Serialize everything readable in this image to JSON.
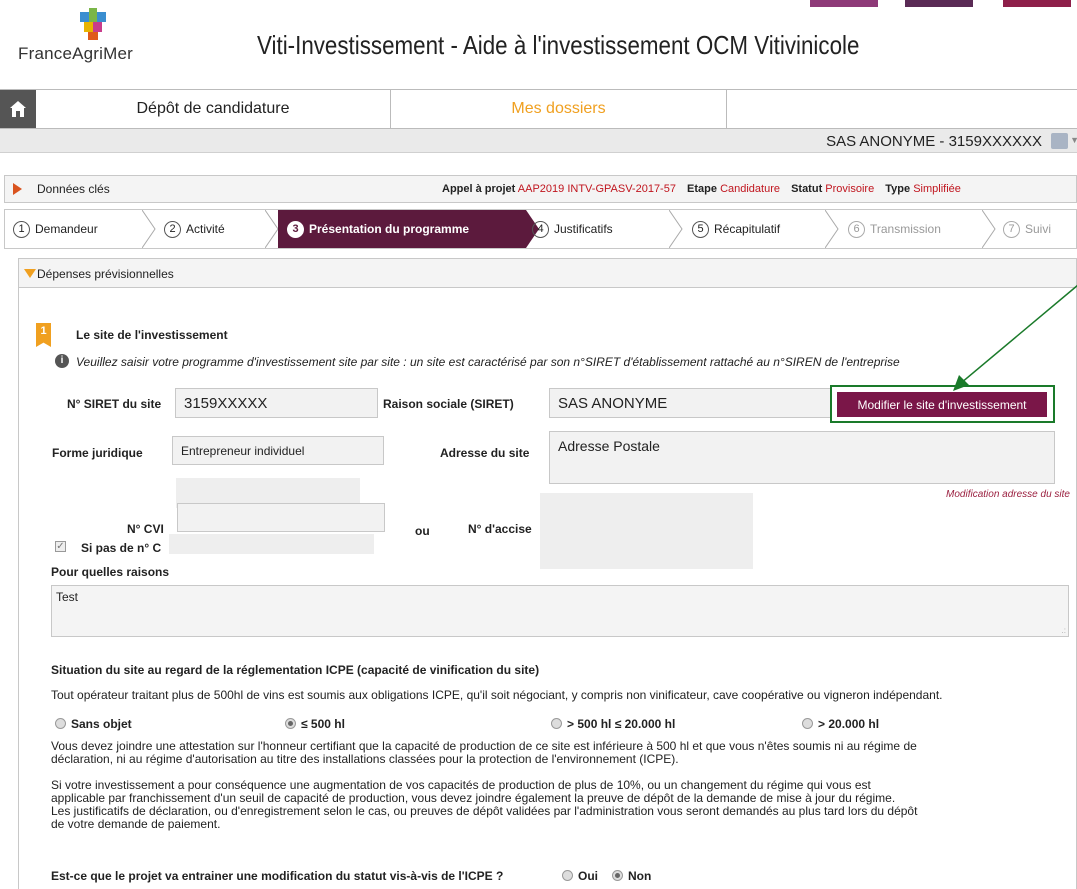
{
  "header": {
    "logo_text": "FranceAgriMer",
    "app_title": "Viti-Investissement - Aide à l'investissement OCM Vitivinicole",
    "top_buttons": [
      {
        "color": "#8e3a78"
      },
      {
        "color": "#5a2a55"
      },
      {
        "color": "#8e1f4a"
      }
    ]
  },
  "nav": {
    "home_icon": "home-icon",
    "tabs": [
      {
        "label": "Dépôt de candidature",
        "color": "#222222"
      },
      {
        "label": "Mes dossiers",
        "color": "#f0a020"
      }
    ]
  },
  "user": {
    "name": "SAS ANONYME - 3159XXXXXX"
  },
  "keybar": {
    "label": "Données clés",
    "appel_label": "Appel à projet",
    "appel_value": "AAP2019 INTV-GPASV-2017-57",
    "etape_label": "Etape",
    "etape_value": "Candidature",
    "statut_label": "Statut",
    "statut_value": "Provisoire",
    "type_label": "Type",
    "type_value": "Simplifiée"
  },
  "steps": [
    {
      "num": "1",
      "label": "Demandeur",
      "state": "done"
    },
    {
      "num": "2",
      "label": "Activité",
      "state": "done"
    },
    {
      "num": "3",
      "label": "Présentation du programme",
      "state": "active"
    },
    {
      "num": "4",
      "label": "Justificatifs",
      "state": "done"
    },
    {
      "num": "5",
      "label": "Récapitulatif",
      "state": "done"
    },
    {
      "num": "6",
      "label": "Transmission",
      "state": "disabled"
    },
    {
      "num": "7",
      "label": "Suivi",
      "state": "disabled"
    }
  ],
  "section": {
    "panel_title": "Dépenses prévisionnelles",
    "badge": "1",
    "site_title": "Le site de l'investissement",
    "info_text": "Veuillez saisir votre programme d'investissement site par site : un site est caractérisé par son n°SIRET d'établissement rattaché au n°SIREN de l'entreprise",
    "siret_label": "N° SIRET du site",
    "siret_value": "3159XXXXX",
    "raison_label": "Raison sociale (SIRET)",
    "raison_value": "SAS ANONYME",
    "modify_button": "Modifier le site d'investissement",
    "forme_label": "Forme juridique",
    "forme_value": "Entrepreneur individuel",
    "adresse_label": "Adresse du site",
    "adresse_value": "Adresse Postale",
    "modif_adresse_link": "Modification adresse du site",
    "cvi_label": "N° CVI",
    "ou_label": "ou",
    "accise_label": "N° d'accise",
    "si_pas_label": "Si pas de n° C",
    "raisons_label": "Pour quelles raisons",
    "raisons_value": "Test"
  },
  "icpe": {
    "title": "Situation du site au regard de la réglementation ICPE (capacité de vinification du site)",
    "intro": "Tout opérateur traitant plus de 500hl de vins est soumis aux obligations ICPE, qu'il soit négociant, y compris non vinificateur, cave coopérative ou vigneron indépendant.",
    "options": [
      {
        "label": "Sans objet",
        "selected": false
      },
      {
        "label": "≤ 500 hl",
        "selected": true
      },
      {
        "label": "> 500 hl ≤ 20.000 hl",
        "selected": false
      },
      {
        "label": "> 20.000 hl",
        "selected": false
      }
    ],
    "para1_line1": "Vous devez joindre une attestation sur l'honneur certifiant que la capacité de production de ce site est inférieure à 500 hl et que vous n'êtes soumis ni au régime de",
    "para1_line2": "déclaration, ni au régime d'autorisation au titre des installations classées pour la protection de l'environnement (ICPE).",
    "para2_line1": "Si votre investissement a pour conséquence une augmentation de vos capacités de production de plus de 10%, ou un changement du régime qui vous est",
    "para2_line2": "applicable par franchissement d'un seuil de capacité de production, vous devez joindre également la preuve de dépôt de la demande de mise à jour du régime.",
    "para2_line3": "Les justificatifs de déclaration, ou d'enregistrement selon le cas, ou preuves de dépôt validées par l'administration vous seront demandés au plus tard lors du dépôt",
    "para2_line4": "de votre demande de paiement.",
    "question": "Est-ce que le projet va entrainer une modification du statut vis-à-vis de l'ICPE ?",
    "answer_oui": "Oui",
    "answer_non": "Non",
    "answer_selected": "Non"
  }
}
